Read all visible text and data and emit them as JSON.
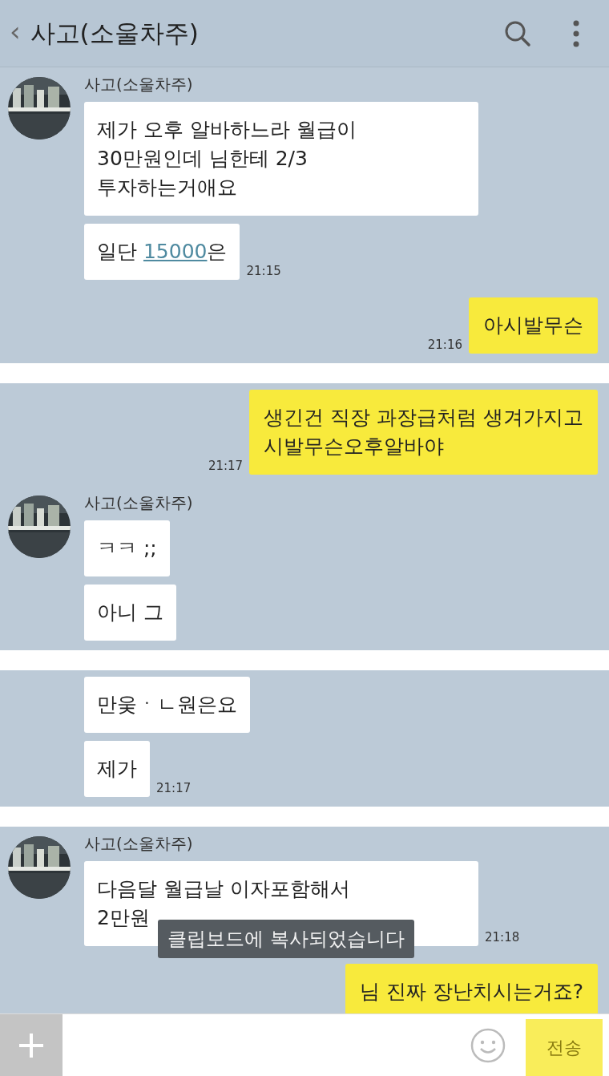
{
  "header": {
    "back": "‹",
    "title": "사고(소울차주)"
  },
  "panels": [
    {
      "groups": [
        {
          "kind": "other",
          "avatar": true,
          "name": "사고(소울차주)",
          "bubbles": [
            {
              "parts": [
                {
                  "text": "제가 오후 알바하느라 월급이\n30만원인데 님한테 2/3\n투자하는거애요"
                }
              ]
            },
            {
              "parts": [
                {
                  "text": "일단 "
                },
                {
                  "text": "15000",
                  "kind": "link"
                },
                {
                  "text": "은"
                }
              ]
            }
          ],
          "time": "21:15"
        },
        {
          "kind": "me",
          "bubbles": [
            {
              "parts": [
                {
                  "text": "아시발무슨"
                }
              ]
            }
          ],
          "time": "21:16"
        }
      ]
    },
    {
      "groups": [
        {
          "kind": "me",
          "bubbles": [
            {
              "parts": [
                {
                  "text": "생긴건 직장 과장급처럼 생겨가지고\n시발무슨오후알바야"
                }
              ]
            }
          ],
          "time": "21:17"
        },
        {
          "kind": "other",
          "avatar": true,
          "name": "사고(소울차주)",
          "bubbles": [
            {
              "parts": [
                {
                  "text": "ㅋㅋ ;;"
                }
              ]
            },
            {
              "parts": [
                {
                  "text": "아니 그"
                }
              ]
            }
          ]
        }
      ]
    },
    {
      "groups": [
        {
          "kind": "other",
          "avatar": false,
          "bubbles": [
            {
              "parts": [
                {
                  "text": "만웆ㆍㄴ원은요"
                }
              ]
            },
            {
              "parts": [
                {
                  "text": "제가"
                }
              ]
            }
          ],
          "time": "21:17"
        }
      ]
    },
    {
      "groups": [
        {
          "kind": "other",
          "avatar": true,
          "name": "사고(소울차주)",
          "bubbles": [
            {
              "parts": [
                {
                  "text": "다음달 월급날 이자포함해서\n2만원"
                }
              ]
            }
          ],
          "time": "21:18"
        },
        {
          "kind": "me",
          "bubbles": [
            {
              "parts": [
                {
                  "text": "님 진짜 장난치시는거죠?"
                }
              ]
            }
          ]
        }
      ],
      "toast": "클립보드에 복사되었습니다"
    }
  ],
  "input": {
    "send_label": "전송",
    "send_disabled": true
  }
}
